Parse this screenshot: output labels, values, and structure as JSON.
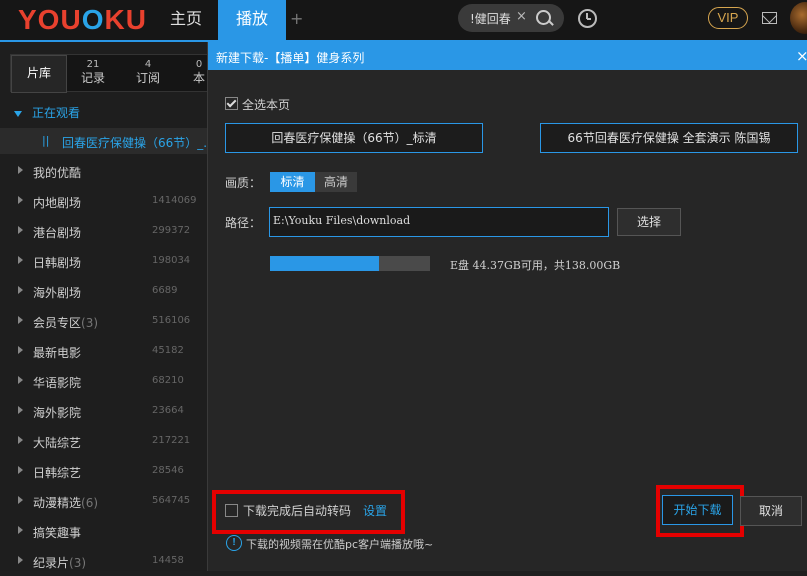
{
  "topbar": {
    "logo_you": "YOU",
    "logo_ku": "KU",
    "nav_home": "主页",
    "nav_play": "播放",
    "nav_add": "+",
    "search_text": "!健回春",
    "vip": "VIP"
  },
  "sidebar": {
    "tabs": [
      {
        "label": "片库",
        "count": ""
      },
      {
        "label": "记录",
        "count": "21"
      },
      {
        "label": "订阅",
        "count": "4"
      },
      {
        "label": "本",
        "count": "0"
      }
    ],
    "watching_header": "正在观看",
    "watching_item": {
      "marker": "||",
      "title": "回春医疗保健操（66节）_..."
    },
    "categories": [
      {
        "label": "我的优酷",
        "count": "",
        "num": ""
      },
      {
        "label": "内地剧场",
        "count": "",
        "num": "1414069"
      },
      {
        "label": "港台剧场",
        "count": "",
        "num": "299372"
      },
      {
        "label": "日韩剧场",
        "count": "",
        "num": "198034"
      },
      {
        "label": "海外剧场",
        "count": "",
        "num": "6689"
      },
      {
        "label": "会员专区",
        "count": "(3)",
        "num": "516106"
      },
      {
        "label": "最新电影",
        "count": "",
        "num": "45182"
      },
      {
        "label": "华语影院",
        "count": "",
        "num": "68210"
      },
      {
        "label": "海外影院",
        "count": "",
        "num": "23664"
      },
      {
        "label": "大陆综艺",
        "count": "",
        "num": "217221"
      },
      {
        "label": "日韩综艺",
        "count": "",
        "num": "28546"
      },
      {
        "label": "动漫精选",
        "count": "(6)",
        "num": "564745"
      },
      {
        "label": "搞笑趣事",
        "count": "",
        "num": ""
      },
      {
        "label": "纪录片",
        "count": "(3)",
        "num": "14458"
      }
    ]
  },
  "dialog": {
    "title": "新建下载-【播单】健身系列",
    "close": "×",
    "select_all": "全选本页",
    "select_all_checked": true,
    "items": [
      "回春医疗保健操（66节）_标清",
      "66节回春医疗保健操 全套演示 陈国锡"
    ],
    "quality_label": "画质：",
    "quality_options": [
      "标清",
      "高清"
    ],
    "quality_selected": "标清",
    "path_label": "路径：",
    "path_value": "E:\\Youku Files\\download",
    "choose_button": "选择",
    "storage_fraction": 0.68,
    "storage_text": "E盘 44.37GB可用，共138.00GB",
    "auto_convert": "下载完成后自动转码",
    "auto_convert_checked": false,
    "settings_link": "设置",
    "start_button": "开始下载",
    "cancel_button": "取消",
    "info_icon": "!",
    "info_text": "下载的视频需在优酷pc客户端播放哦~"
  },
  "colors": {
    "accent": "#2a97e6",
    "highlight": "#e50000",
    "logo_red": "#e8412e",
    "vip_gold": "#d7a64f"
  }
}
